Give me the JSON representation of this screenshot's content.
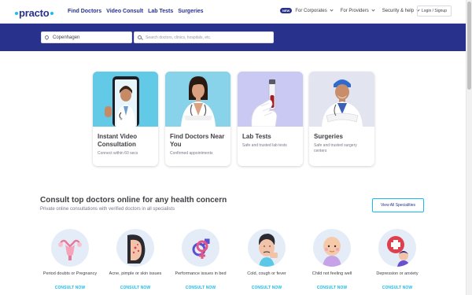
{
  "header": {
    "logo": "practo",
    "nav": [
      "Find Doctors",
      "Video Consult",
      "Lab Tests",
      "Surgeries"
    ],
    "new_badge": "NEW",
    "corporates": "For Corporates",
    "providers": "For Providers",
    "security": "Security & help",
    "login": "Login / Signup"
  },
  "search": {
    "location": "Copenhagen",
    "placeholder": "Search doctors, clinics, hospitals, etc."
  },
  "services": [
    {
      "title": "Instant Video Consultation",
      "subtitle": "Connect within 60 secs"
    },
    {
      "title": "Find Doctors Near You",
      "subtitle": "Confirmed appointments"
    },
    {
      "title": "Lab Tests",
      "subtitle": "Safe and trusted lab tests"
    },
    {
      "title": "Surgeries",
      "subtitle": "Safe and trusted surgery centers"
    }
  ],
  "specialities_section": {
    "title": "Consult top doctors online for any health concern",
    "subtitle": "Private online consultations with verified doctors in all specialists",
    "view_all": "View All Specialities"
  },
  "specialities": [
    {
      "label": "Period doubts or Pregnancy",
      "cta": "CONSULT NOW",
      "icon": "uterus-icon"
    },
    {
      "label": "Acne, pimple or skin issues",
      "cta": "CONSULT NOW",
      "icon": "acne-face-icon"
    },
    {
      "label": "Performance issues in bed",
      "cta": "CONSULT NOW",
      "icon": "gender-symbols-icon"
    },
    {
      "label": "Cold, cough or fever",
      "cta": "CONSULT NOW",
      "icon": "sick-face-icon"
    },
    {
      "label": "Child not feeling well",
      "cta": "CONSULT NOW",
      "icon": "baby-icon"
    },
    {
      "label": "Depression or anxiety",
      "cta": "CONSULT NOW",
      "icon": "mental-health-icon"
    }
  ],
  "colors": {
    "brand": "#28328c",
    "accent": "#14bef0",
    "text": "#414146"
  }
}
